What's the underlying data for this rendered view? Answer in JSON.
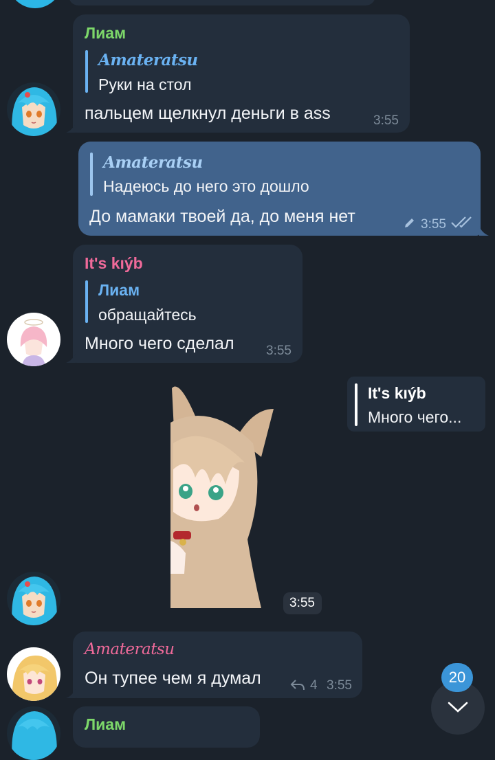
{
  "colors": {
    "background": "#1b222b",
    "bubble_in": "#232e3c",
    "bubble_out": "#41638c",
    "name_liam": "#7dd86a",
    "name_kiyb": "#f06a9a",
    "name_amaterasu_blue": "#6ab2f2",
    "name_amaterasu_pink": "#f06a9a",
    "badge": "#3b95d8"
  },
  "messages": {
    "m1": {
      "sender": "Лиам",
      "reply_to": "Amateratsu",
      "reply_text": "Руки на стол",
      "text": "пальцем щелкнул деньги в ass",
      "time": "3:55"
    },
    "m2": {
      "reply_to": "Amateratsu",
      "reply_text": "Надеюсь до него это дошло",
      "text": "До мамаки твоей да, до меня нет",
      "time": "3:55",
      "edited_icon": "pencil-icon",
      "status_icon": "double-check-icon"
    },
    "m3": {
      "sender": "It's kıýb",
      "reply_to": "Лиам",
      "reply_text": "обращайтесь",
      "text": "Много чего сделал",
      "time": "3:55"
    },
    "m4": {
      "reply_to": "It's kıýb",
      "reply_text": "Много чего...",
      "time": "3:55",
      "sticker": "fox-girl-sticker"
    },
    "m5": {
      "sender": "Amateratsu",
      "text": "Он тупее чем я думал",
      "replies_count": "4",
      "time": "3:55"
    },
    "m6": {
      "sender": "Лиам"
    }
  },
  "scroll_button": {
    "unread_count": "20",
    "icon": "chevron-down-icon"
  }
}
